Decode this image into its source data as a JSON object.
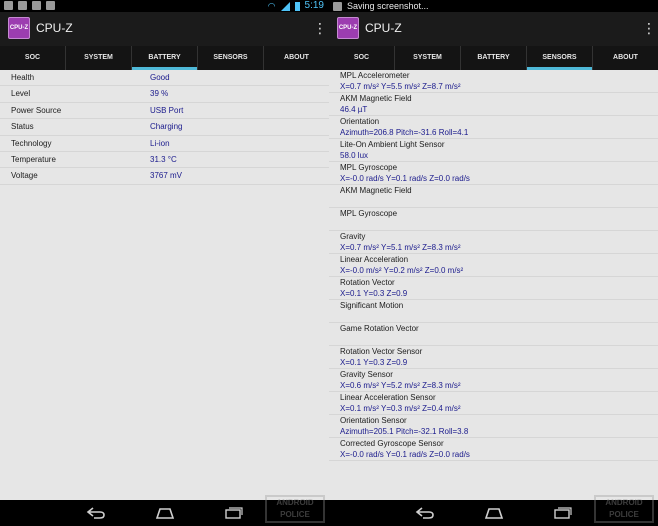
{
  "left": {
    "status_bar": {
      "time": "5:19"
    },
    "app": {
      "title": "CPU-Z",
      "logo_text": "CPU-Z"
    },
    "tabs": [
      {
        "label": "SOC",
        "active": false
      },
      {
        "label": "SYSTEM",
        "active": false
      },
      {
        "label": "BATTERY",
        "active": true
      },
      {
        "label": "SENSORS",
        "active": false
      },
      {
        "label": "ABOUT",
        "active": false
      }
    ],
    "battery": [
      {
        "label": "Health",
        "value": "Good"
      },
      {
        "label": "Level",
        "value": "39 %"
      },
      {
        "label": "Power Source",
        "value": "USB Port"
      },
      {
        "label": "Status",
        "value": "Charging"
      },
      {
        "label": "Technology",
        "value": "Li-ion"
      },
      {
        "label": "Temperature",
        "value": "31.3 °C"
      },
      {
        "label": "Voltage",
        "value": "3767 mV"
      }
    ]
  },
  "right": {
    "status_bar": {
      "notification": "Saving screenshot..."
    },
    "app": {
      "title": "CPU-Z",
      "logo_text": "CPU-Z"
    },
    "tabs": [
      {
        "label": "SOC",
        "active": false
      },
      {
        "label": "SYSTEM",
        "active": false
      },
      {
        "label": "BATTERY",
        "active": false
      },
      {
        "label": "SENSORS",
        "active": true
      },
      {
        "label": "ABOUT",
        "active": false
      }
    ],
    "sensors": [
      {
        "name": "MPL Accelerometer",
        "value": "X=0.7 m/s²   Y=5.5 m/s²   Z=8.7 m/s²"
      },
      {
        "name": "AKM Magnetic Field",
        "value": "46.4 µT"
      },
      {
        "name": "Orientation",
        "value": "Azimuth=206.8   Pitch=-31.6   Roll=4.1"
      },
      {
        "name": "Lite-On Ambient Light Sensor",
        "value": "58.0 lux"
      },
      {
        "name": "MPL Gyroscope",
        "value": "X=-0.0 rad/s   Y=0.1 rad/s   Z=0.0 rad/s"
      },
      {
        "name": "AKM Magnetic Field",
        "value": ""
      },
      {
        "name": "MPL Gyroscope",
        "value": ""
      },
      {
        "name": "Gravity",
        "value": "X=0.7 m/s²   Y=5.1 m/s²   Z=8.3 m/s²"
      },
      {
        "name": "Linear Acceleration",
        "value": "X=-0.0 m/s²   Y=0.2 m/s²   Z=0.0 m/s²"
      },
      {
        "name": "Rotation Vector",
        "value": "X=0.1   Y=0.3   Z=0.9"
      },
      {
        "name": "Significant Motion",
        "value": ""
      },
      {
        "name": "Game Rotation Vector",
        "value": ""
      },
      {
        "name": "Rotation Vector Sensor",
        "value": "X=0.1   Y=0.3   Z=0.9"
      },
      {
        "name": "Gravity Sensor",
        "value": "X=0.6 m/s²   Y=5.2 m/s²   Z=8.3 m/s²"
      },
      {
        "name": "Linear Acceleration Sensor",
        "value": "X=0.1 m/s²   Y=0.3 m/s²   Z=0.4 m/s²"
      },
      {
        "name": "Orientation Sensor",
        "value": "Azimuth=205.1   Pitch=-32.1   Roll=3.8"
      },
      {
        "name": "Corrected Gyroscope Sensor",
        "value": "X=-0.0 rad/s   Y=0.1 rad/s   Z=0.0 rad/s"
      }
    ]
  },
  "watermark": "ANDROID POLICE",
  "colors": {
    "accent": "#4fb9d8",
    "value_text": "#1a1a8c",
    "logo": "#9c3db0"
  }
}
